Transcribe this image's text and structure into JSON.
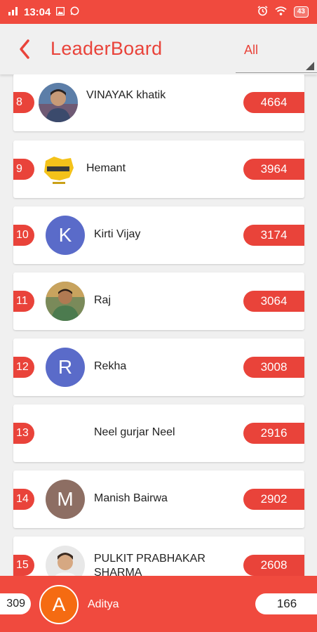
{
  "status_bar": {
    "time": "13:04",
    "signal_icon": "signal-icon",
    "notification_icons": [
      "photo-icon",
      "whatsapp-icon"
    ],
    "status_icons": [
      "alarm-icon",
      "wifi-icon"
    ],
    "battery": "43"
  },
  "header": {
    "back_icon": "back-arrow-icon",
    "title": "LeaderBoard",
    "filter_selected": "All",
    "colors": {
      "accent": "#e9433a",
      "background": "#f0f0f0"
    }
  },
  "leaderboard": [
    {
      "rank": "8",
      "name": "VINAYAK khatik",
      "score": "4664",
      "avatar": "photo"
    },
    {
      "rank": "9",
      "name": "Hemant",
      "score": "3964",
      "avatar": "logo"
    },
    {
      "rank": "10",
      "name": "Kirti Vijay",
      "score": "3174",
      "avatar": "K",
      "avatar_color": "#5a6bc9"
    },
    {
      "rank": "11",
      "name": "Raj",
      "score": "3064",
      "avatar": "photo"
    },
    {
      "rank": "12",
      "name": "Rekha",
      "score": "3008",
      "avatar": "R",
      "avatar_color": "#5a6bc9"
    },
    {
      "rank": "13",
      "name": "Neel gurjar Neel",
      "score": "2916",
      "avatar": "none"
    },
    {
      "rank": "14",
      "name": "Manish Bairwa",
      "score": "2902",
      "avatar": "M",
      "avatar_color": "#8d6e63"
    },
    {
      "rank": "15",
      "name": "PULKIT PRABHAKAR SHARMA",
      "score": "2608",
      "avatar": "photo"
    }
  ],
  "current_user": {
    "rank": "309",
    "avatar_letter": "A",
    "avatar_color": "#f56b12",
    "name": "Aditya",
    "score": "166"
  }
}
